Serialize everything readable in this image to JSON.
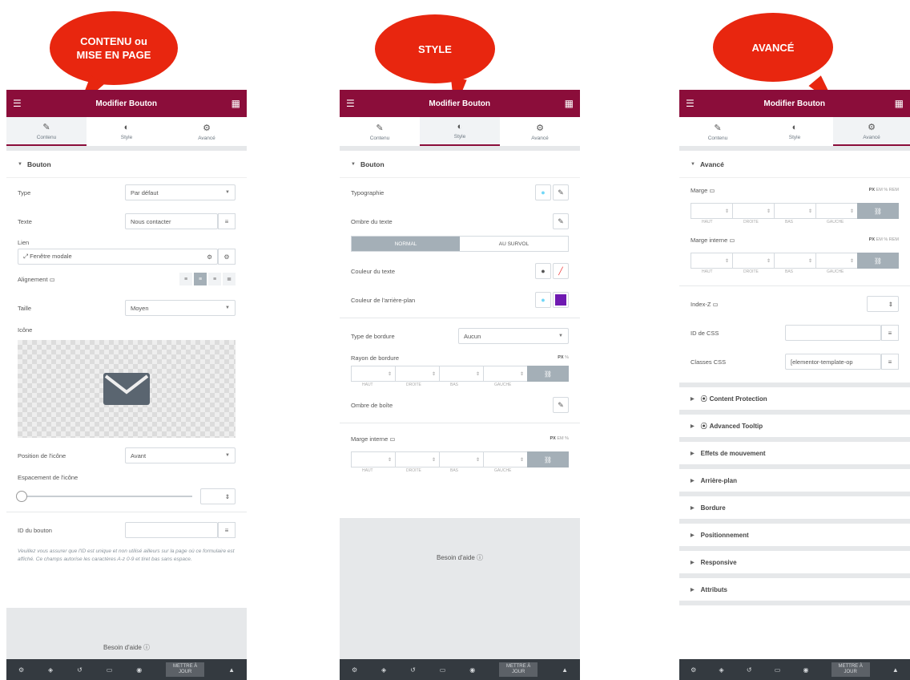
{
  "bubbles": {
    "b1_line1": "CONTENU ou",
    "b1_line2": "MISE EN PAGE",
    "b2": "STYLE",
    "b3": "AVANCÉ"
  },
  "header": {
    "title": "Modifier Bouton"
  },
  "tabs": {
    "content": "Contenu",
    "style": "Style",
    "advanced": "Avancé"
  },
  "panel1": {
    "section": "Bouton",
    "type_label": "Type",
    "type_value": "Par défaut",
    "text_label": "Texte",
    "text_value": "Nous contacter",
    "link_label": "Lien",
    "link_value": "Fenêtre modale",
    "align_label": "Alignement",
    "size_label": "Taille",
    "size_value": "Moyen",
    "icon_label": "Icône",
    "icon_pos_label": "Position de l'icône",
    "icon_pos_value": "Avant",
    "icon_spacing_label": "Espacement de l'icône",
    "id_label": "ID du bouton",
    "hint": "Veuillez vous assurer que l'ID est unique et non utilisé ailleurs sur la page où ce formulaire est affiché. Ce champs autorise les caractères A-z  0-9 et tiret bas sans espace.",
    "help": "Besoin d'aide"
  },
  "panel2": {
    "section": "Bouton",
    "typography_label": "Typographie",
    "text_shadow_label": "Ombre du texte",
    "normal": "NORMAL",
    "hover": "AU SURVOL",
    "text_color_label": "Couleur du texte",
    "bg_color_label": "Couleur de l'arrière-plan",
    "border_type_label": "Type de bordure",
    "border_type_value": "Aucun",
    "border_radius_label": "Rayon de bordure",
    "box_shadow_label": "Ombre de boîte",
    "padding_label": "Marge interne",
    "help": "Besoin d'aide"
  },
  "panel3": {
    "section": "Avancé",
    "margin_label": "Marge",
    "padding_label": "Marge interne",
    "zindex_label": "Index-Z",
    "css_id_label": "ID de CSS",
    "css_classes_label": "Classes CSS",
    "css_classes_value": "[elementor-template-op",
    "accordions": [
      "Content Protection",
      "Advanced Tooltip",
      "Effets de mouvement",
      "Arrière-plan",
      "Bordure",
      "Positionnement",
      "Responsive",
      "Attributs"
    ]
  },
  "dims": {
    "top": "HAUT",
    "right": "DROITE",
    "bottom": "BAS",
    "left": "GAUCHE",
    "unit_px": "PX",
    "unit_em": "EM",
    "unit_pct": "%",
    "unit_rem": "REM"
  },
  "footer": {
    "update_line1": "METTRE À",
    "update_line2": "JOUR"
  },
  "colors": {
    "header": "#8b0d3a",
    "bubble": "#e8260f",
    "bg_swatch": "#6f1ab1",
    "footer": "#343a40"
  }
}
